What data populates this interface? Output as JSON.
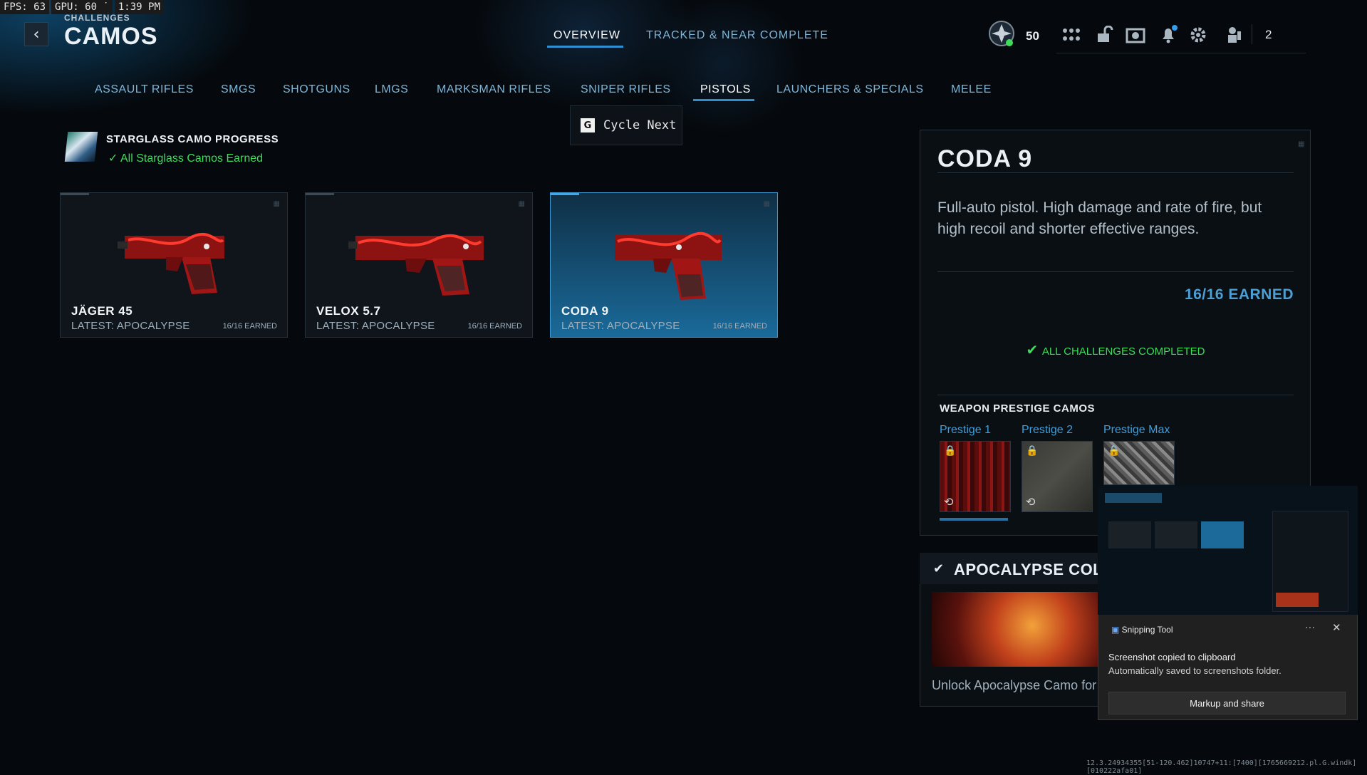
{
  "perf": {
    "fps": "FPS:  63",
    "gpu": "GPU: 60 ˙",
    "time": "1:39 PM"
  },
  "header": {
    "breadcrumb": "CHALLENGES",
    "title": "CAMOS",
    "tabs": [
      {
        "label": "OVERVIEW",
        "active": true
      },
      {
        "label": "TRACKED & NEAR COMPLETE",
        "active": false
      }
    ],
    "rank": "50",
    "party_count": "2",
    "icons": [
      "rank-emblem-icon",
      "apps-grid-icon",
      "unlock-icon",
      "camera-icon",
      "bell-icon",
      "gear-icon",
      "party-icon"
    ]
  },
  "categories": [
    {
      "label": "ASSAULT RIFLES"
    },
    {
      "label": "SMGS"
    },
    {
      "label": "SHOTGUNS"
    },
    {
      "label": "LMGS"
    },
    {
      "label": "MARKSMAN RIFLES"
    },
    {
      "label": "SNIPER RIFLES"
    },
    {
      "label": "PISTOLS",
      "active": true
    },
    {
      "label": "LAUNCHERS & SPECIALS"
    },
    {
      "label": "MELEE"
    }
  ],
  "cycle": {
    "key": "G",
    "label": "Cycle Next"
  },
  "starglass": {
    "title": "STARGLASS CAMO PROGRESS",
    "status": "All Starglass Camos Earned"
  },
  "weapons": [
    {
      "name": "JÄGER 45",
      "latest": "LATEST: APOCALYPSE",
      "earned": "16/16 EARNED"
    },
    {
      "name": "VELOX 5.7",
      "latest": "LATEST: APOCALYPSE",
      "earned": "16/16 EARNED"
    },
    {
      "name": "CODA 9",
      "latest": "LATEST: APOCALYPSE",
      "earned": "16/16 EARNED",
      "selected": true
    }
  ],
  "detail": {
    "name": "CODA 9",
    "description": "Full-auto pistol. High damage and rate of fire, but high recoil and shorter effective ranges.",
    "earned": "16/16 EARNED",
    "completed": "ALL CHALLENGES COMPLETED",
    "prestige_heading": "WEAPON PRESTIGE CAMOS",
    "prestige": [
      {
        "label": "Prestige 1"
      },
      {
        "label": "Prestige 2"
      },
      {
        "label": "Prestige Max"
      }
    ]
  },
  "collection": {
    "title": "APOCALYPSE COLLE",
    "description": "Unlock Apocalypse Camo for any"
  },
  "snipping": {
    "app": "Snipping Tool",
    "dots": "···",
    "message": "Screenshot copied to clipboard",
    "sub": "Automatically saved to screenshots folder.",
    "button": "Markup and share"
  },
  "build": "12.3.24934355[51-120.462]10747+11:[7400][1765669212.pl.G.windk][010222afa01]",
  "colors": {
    "accent": "#2f8fd0",
    "success": "#3fdc5a",
    "selected_card": "#1a6a9a"
  }
}
